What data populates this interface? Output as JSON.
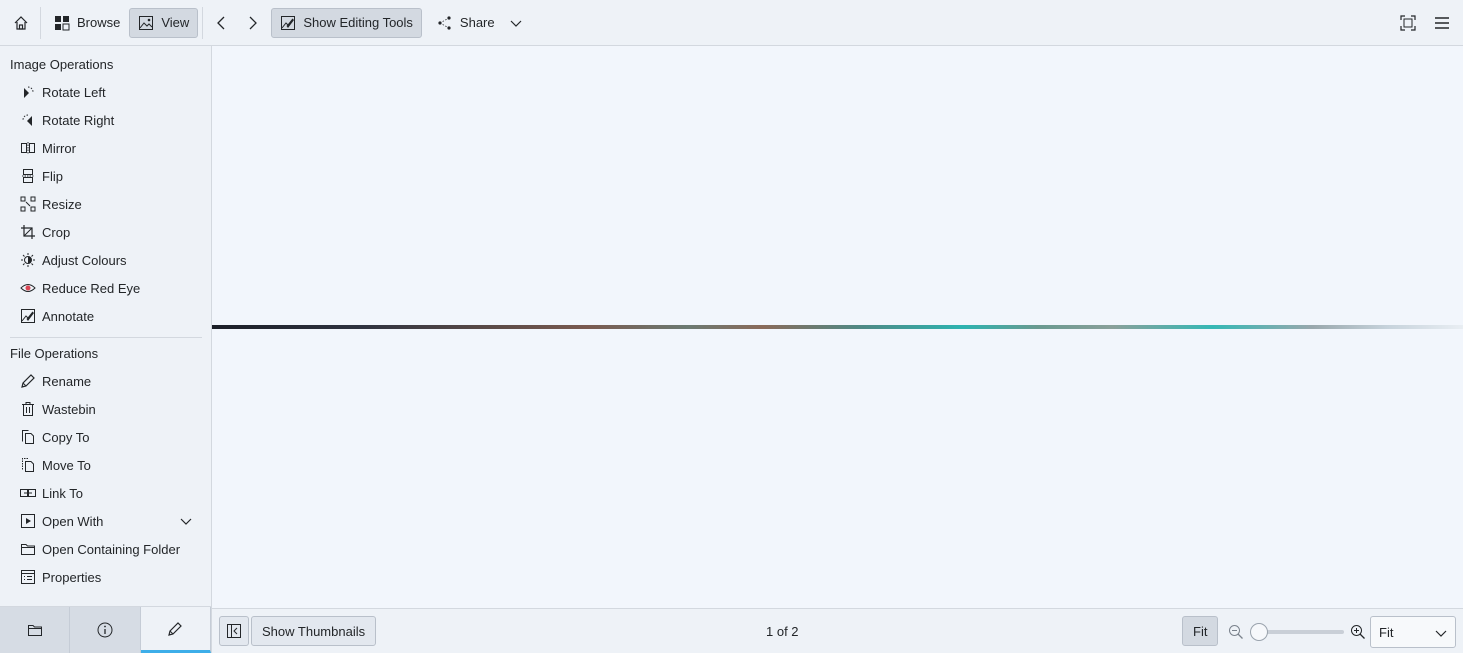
{
  "toolbar": {
    "browse_label": "Browse",
    "view_label": "View",
    "editing_tools_label": "Show Editing Tools",
    "share_label": "Share"
  },
  "sidebar": {
    "image_ops_title": "Image Operations",
    "image_ops": [
      {
        "label": "Rotate Left",
        "icon": "rotate-left-icon"
      },
      {
        "label": "Rotate Right",
        "icon": "rotate-right-icon"
      },
      {
        "label": "Mirror",
        "icon": "mirror-icon"
      },
      {
        "label": "Flip",
        "icon": "flip-icon"
      },
      {
        "label": "Resize",
        "icon": "resize-icon"
      },
      {
        "label": "Crop",
        "icon": "crop-icon"
      },
      {
        "label": "Adjust Colours",
        "icon": "adjust-colours-icon"
      },
      {
        "label": "Reduce Red Eye",
        "icon": "eye-icon"
      },
      {
        "label": "Annotate",
        "icon": "annotate-icon"
      }
    ],
    "file_ops_title": "File Operations",
    "file_ops": [
      {
        "label": "Rename",
        "icon": "pencil-icon"
      },
      {
        "label": "Wastebin",
        "icon": "trash-icon"
      },
      {
        "label": "Copy To",
        "icon": "copy-icon"
      },
      {
        "label": "Move To",
        "icon": "move-icon"
      },
      {
        "label": "Link To",
        "icon": "link-icon"
      },
      {
        "label": "Open With",
        "icon": "open-with-icon"
      },
      {
        "label": "Open Containing Folder",
        "icon": "folder-icon"
      },
      {
        "label": "Properties",
        "icon": "properties-icon"
      }
    ]
  },
  "bottombar": {
    "thumbnails_label": "Show Thumbnails",
    "page_indicator": "1 of 2",
    "fit_label": "Fit",
    "zoom_value": "Fit"
  }
}
